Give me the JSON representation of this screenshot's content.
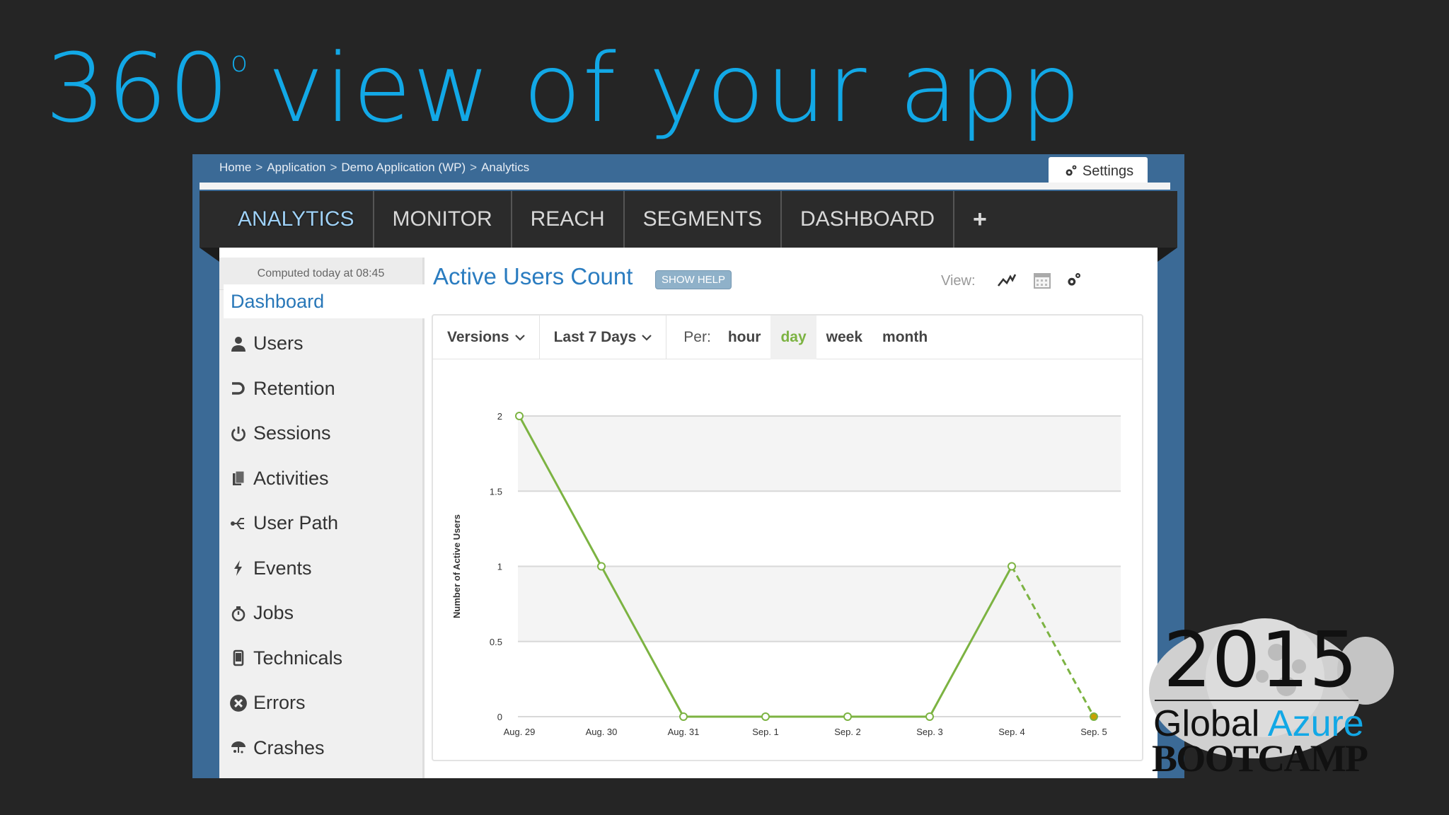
{
  "slide": {
    "title_number": "360",
    "title_degree": "o",
    "title_rest": "view of your app"
  },
  "breadcrumb": [
    "Home",
    "Application",
    "Demo Application (WP)",
    "Analytics"
  ],
  "breadcrumb_sep": ">",
  "settings_label": "Settings",
  "nav": {
    "items": [
      "ANALYTICS",
      "MONITOR",
      "REACH",
      "SEGMENTS",
      "DASHBOARD"
    ],
    "plus": "+"
  },
  "sidebar": {
    "computed": "Computed today at 08:45",
    "active": "Dashboard",
    "items": [
      {
        "label": "Users",
        "icon": "user-icon"
      },
      {
        "label": "Retention",
        "icon": "retention-icon"
      },
      {
        "label": "Sessions",
        "icon": "power-icon"
      },
      {
        "label": "Activities",
        "icon": "pages-icon"
      },
      {
        "label": "User Path",
        "icon": "path-icon"
      },
      {
        "label": "Events",
        "icon": "bolt-icon"
      },
      {
        "label": "Jobs",
        "icon": "stopwatch-icon"
      },
      {
        "label": "Technicals",
        "icon": "phone-icon"
      },
      {
        "label": "Errors",
        "icon": "error-icon"
      },
      {
        "label": "Crashes",
        "icon": "crash-icon"
      }
    ]
  },
  "main": {
    "title": "Active Users Count",
    "help": "SHOW HELP",
    "view_label": "View:",
    "filters": {
      "versions": "Versions",
      "range": "Last 7 Days",
      "per_label": "Per:",
      "per_options": [
        "hour",
        "day",
        "week",
        "month"
      ],
      "per_selected": "day"
    }
  },
  "colors": {
    "accent": "#12a8e6",
    "line": "#7cb342",
    "last_point": "#c8a000"
  },
  "chart_data": {
    "type": "line",
    "categories": [
      "Aug. 29",
      "Aug. 30",
      "Aug. 31",
      "Sep. 1",
      "Sep. 2",
      "Sep. 3",
      "Sep. 4",
      "Sep. 5"
    ],
    "values": [
      2,
      1,
      0,
      0,
      0,
      0,
      1,
      0
    ],
    "ylabel": "Number of Active Users",
    "yticks": [
      "0",
      "0.5",
      "1",
      "1.5",
      "2"
    ],
    "ylim": [
      0,
      2
    ],
    "last_segment": "dashed"
  }
}
